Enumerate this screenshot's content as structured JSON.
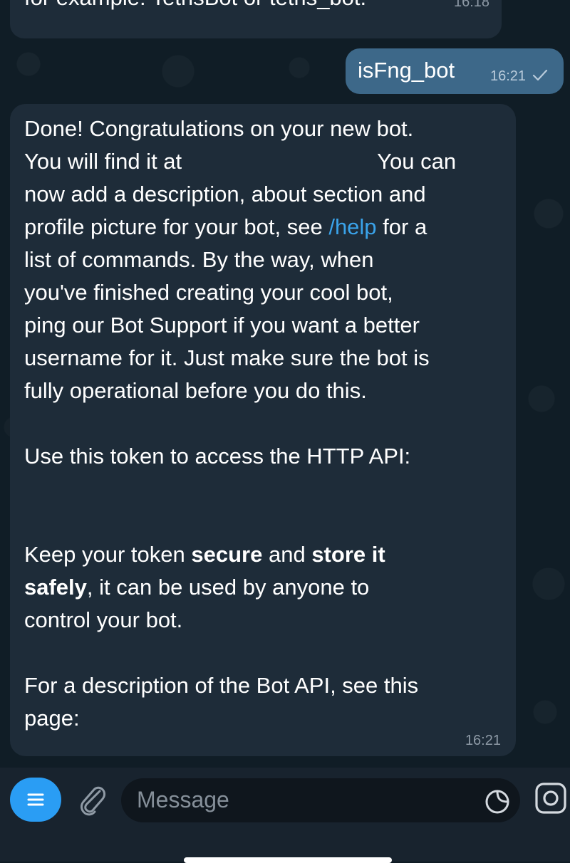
{
  "colors": {
    "background": "#101d26",
    "incoming_bubble": "#1e2c39",
    "outgoing_bubble": "#3d6889",
    "link": "#3aa3ea",
    "menu_button": "#2a9df4",
    "input_background": "#0f161d",
    "bottom_bar": "#18232e"
  },
  "messages": {
    "top": {
      "text": "for example: TetrisBot or tetris_bot.",
      "time": "16:18"
    },
    "outgoing": {
      "text": "isFng_bot",
      "time": "16:21",
      "status_icon": "single-check-icon"
    },
    "main": {
      "p1": {
        "l1": "Done! Congratulations on your new bot.",
        "l2a": "You will find it at",
        "l2b": "You can",
        "l3": "now add a description, about section and",
        "l4a": "profile picture for your bot, see ",
        "l4link": "/help",
        "l4b": " for a",
        "l5": "list of commands. By the way, when",
        "l6": "you've finished creating your cool bot,",
        "l7": "ping our Bot Support if you want a better",
        "l8": "username for it. Just make sure the bot is",
        "l9": "fully operational before you do this."
      },
      "p2": "Use this token to access the HTTP API:",
      "p3": {
        "a": "Keep your token ",
        "b1": "secure",
        "c": " and ",
        "b2": "store it",
        "b3": "safely",
        "d": ", it can be used by anyone to",
        "e": "control your bot."
      },
      "p4": {
        "l1": "For a description of the Bot API, see this",
        "l2": "page:"
      },
      "time": "16:21"
    }
  },
  "input": {
    "placeholder": "Message",
    "icons": {
      "menu": "menu-icon",
      "attach": "paperclip-icon",
      "sticker": "sticker-icon",
      "camera": "camera-icon"
    }
  }
}
